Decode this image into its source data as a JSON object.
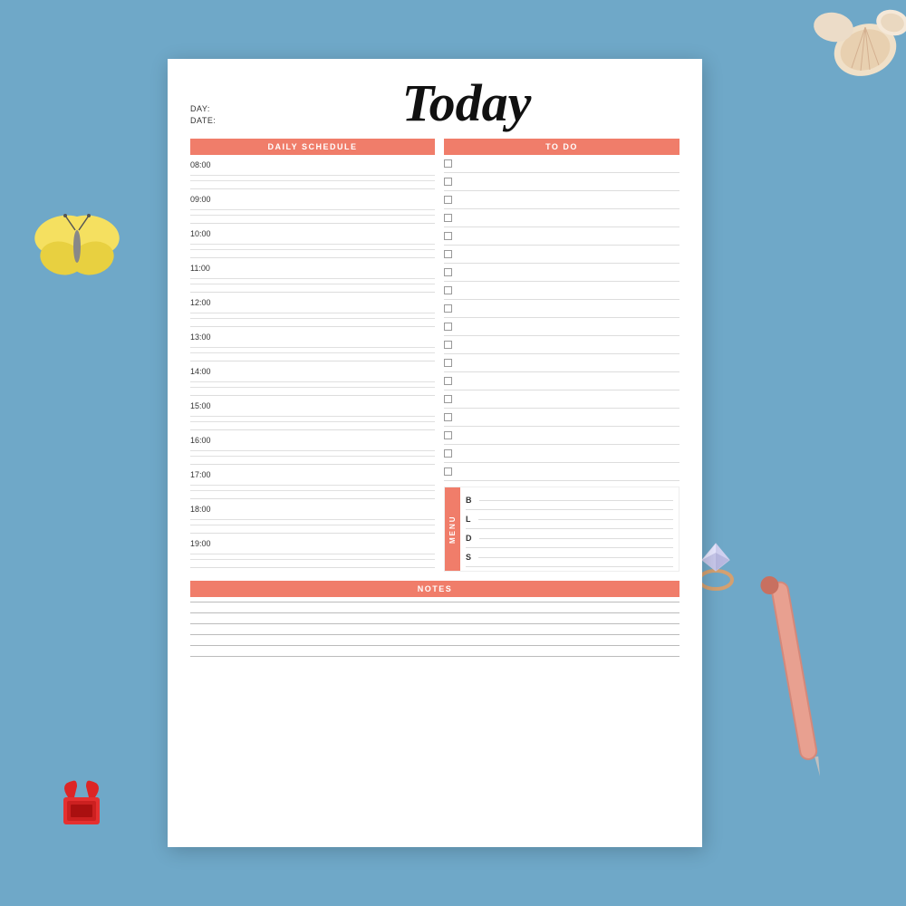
{
  "background": {
    "color": "#6fa8c8"
  },
  "header": {
    "day_label": "DAY:",
    "date_label": "DATE:",
    "title": "Today"
  },
  "daily_schedule": {
    "header": "DAILY SCHEDULE",
    "times": [
      "08:00",
      "09:00",
      "10:00",
      "11:00",
      "12:00",
      "13:00",
      "14:00",
      "15:00",
      "16:00",
      "17:00",
      "18:00",
      "19:00"
    ]
  },
  "todo": {
    "header": "TO DO",
    "items_count": 18
  },
  "menu": {
    "label": "MENU",
    "items": [
      {
        "letter": "B",
        "label": ""
      },
      {
        "letter": "L",
        "label": ""
      },
      {
        "letter": "D",
        "label": ""
      },
      {
        "letter": "S",
        "label": ""
      }
    ]
  },
  "notes": {
    "header": "NOTES",
    "lines_count": 6
  },
  "accent_color": "#f07d6a"
}
